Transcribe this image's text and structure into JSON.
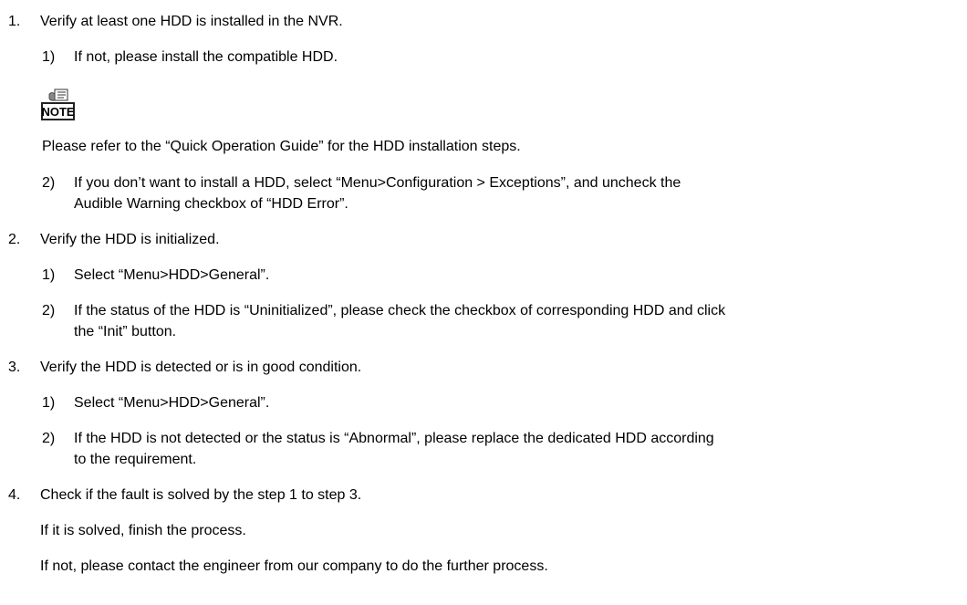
{
  "steps": [
    {
      "number": "1.",
      "text": "Verify at least one HDD is installed in the NVR.",
      "substeps": [
        {
          "number": "1)",
          "text": "If not, please install the compatible HDD."
        },
        {
          "number": "2)",
          "text": "If you don’t want to install a HDD, select “Menu>Configuration > Exceptions”, and uncheck the",
          "text_cont": "Audible Warning checkbox of “HDD Error”."
        }
      ],
      "note": {
        "icon_label": "NOTE",
        "text": "Please refer to the “Quick Operation Guide” for the HDD installation steps."
      }
    },
    {
      "number": "2.",
      "text": "Verify the HDD is initialized.",
      "substeps": [
        {
          "number": "1)",
          "text": "Select “Menu>HDD>General”."
        },
        {
          "number": "2)",
          "text": "If the status of the HDD is “Uninitialized”, please check the checkbox of corresponding HDD and click",
          "text_cont": "the “Init” button."
        }
      ]
    },
    {
      "number": "3.",
      "text": "Verify the HDD is detected or is in good condition.",
      "substeps": [
        {
          "number": "1)",
          "text": "Select “Menu>HDD>General”."
        },
        {
          "number": "2)",
          "text": "If the HDD is not detected or the status is “Abnormal”, please replace the dedicated HDD according",
          "text_cont": "to the requirement."
        }
      ]
    },
    {
      "number": "4.",
      "text": "Check if the fault is solved by the step 1 to step 3.",
      "paragraphs": [
        "If it is solved, finish the process.",
        "If not, please contact the engineer from our company to do the further process."
      ]
    }
  ]
}
